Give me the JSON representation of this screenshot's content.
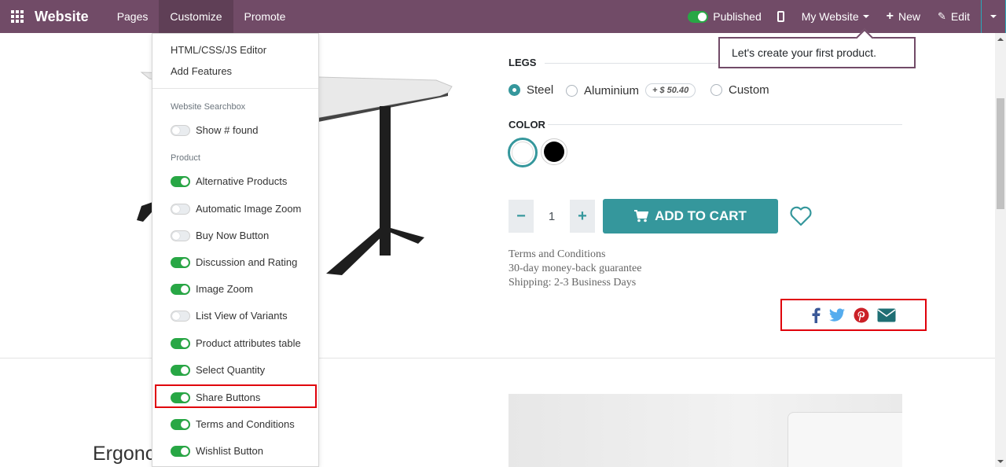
{
  "topbar": {
    "brand": "Website",
    "nav": [
      "Pages",
      "Customize",
      "Promote"
    ],
    "published_label": "Published",
    "website_selector": "My Website",
    "new_label": "New",
    "edit_label": "Edit"
  },
  "customize_menu": {
    "items": [
      "HTML/CSS/JS Editor",
      "Add Features"
    ],
    "searchbox_header": "Website Searchbox",
    "searchbox_options": [
      {
        "label": "Show # found",
        "on": false
      }
    ],
    "product_header": "Product",
    "product_options": [
      {
        "label": "Alternative Products",
        "on": true
      },
      {
        "label": "Automatic Image Zoom",
        "on": false
      },
      {
        "label": "Buy Now Button",
        "on": false
      },
      {
        "label": "Discussion and Rating",
        "on": true
      },
      {
        "label": "Image Zoom",
        "on": true
      },
      {
        "label": "List View of Variants",
        "on": false
      },
      {
        "label": "Product attributes table",
        "on": true
      },
      {
        "label": "Select Quantity",
        "on": true
      },
      {
        "label": "Share Buttons",
        "on": true
      },
      {
        "label": "Terms and Conditions",
        "on": true
      },
      {
        "label": "Wishlist Button",
        "on": true
      }
    ]
  },
  "tooltip": "Let's create your first product.",
  "product": {
    "legs_label": "LEGS",
    "legs_options": [
      {
        "label": "Steel",
        "selected": true
      },
      {
        "label": "Aluminium",
        "selected": false,
        "extra_price": "+ $ 50.40"
      },
      {
        "label": "Custom",
        "selected": false
      }
    ],
    "color_label": "COLOR",
    "colors": [
      {
        "value": "#ffffff",
        "selected": true
      },
      {
        "value": "#000000",
        "selected": false
      }
    ],
    "quantity": "1",
    "add_to_cart": "ADD TO CART",
    "info_lines": [
      "Terms and Conditions",
      "30-day money-back guarantee",
      "Shipping: 2-3 Business Days"
    ],
    "share_icons": [
      "facebook-icon",
      "twitter-icon",
      "pinterest-icon",
      "email-icon"
    ],
    "bottom_title": "Ergonc"
  },
  "colors": {
    "topbar": "#714b67",
    "accent": "#35979c",
    "toggle_on": "#28a745",
    "highlight": "#e0000b",
    "facebook": "#3b5998",
    "twitter": "#55acee",
    "pinterest": "#cb2027",
    "email": "#1f6f74"
  }
}
